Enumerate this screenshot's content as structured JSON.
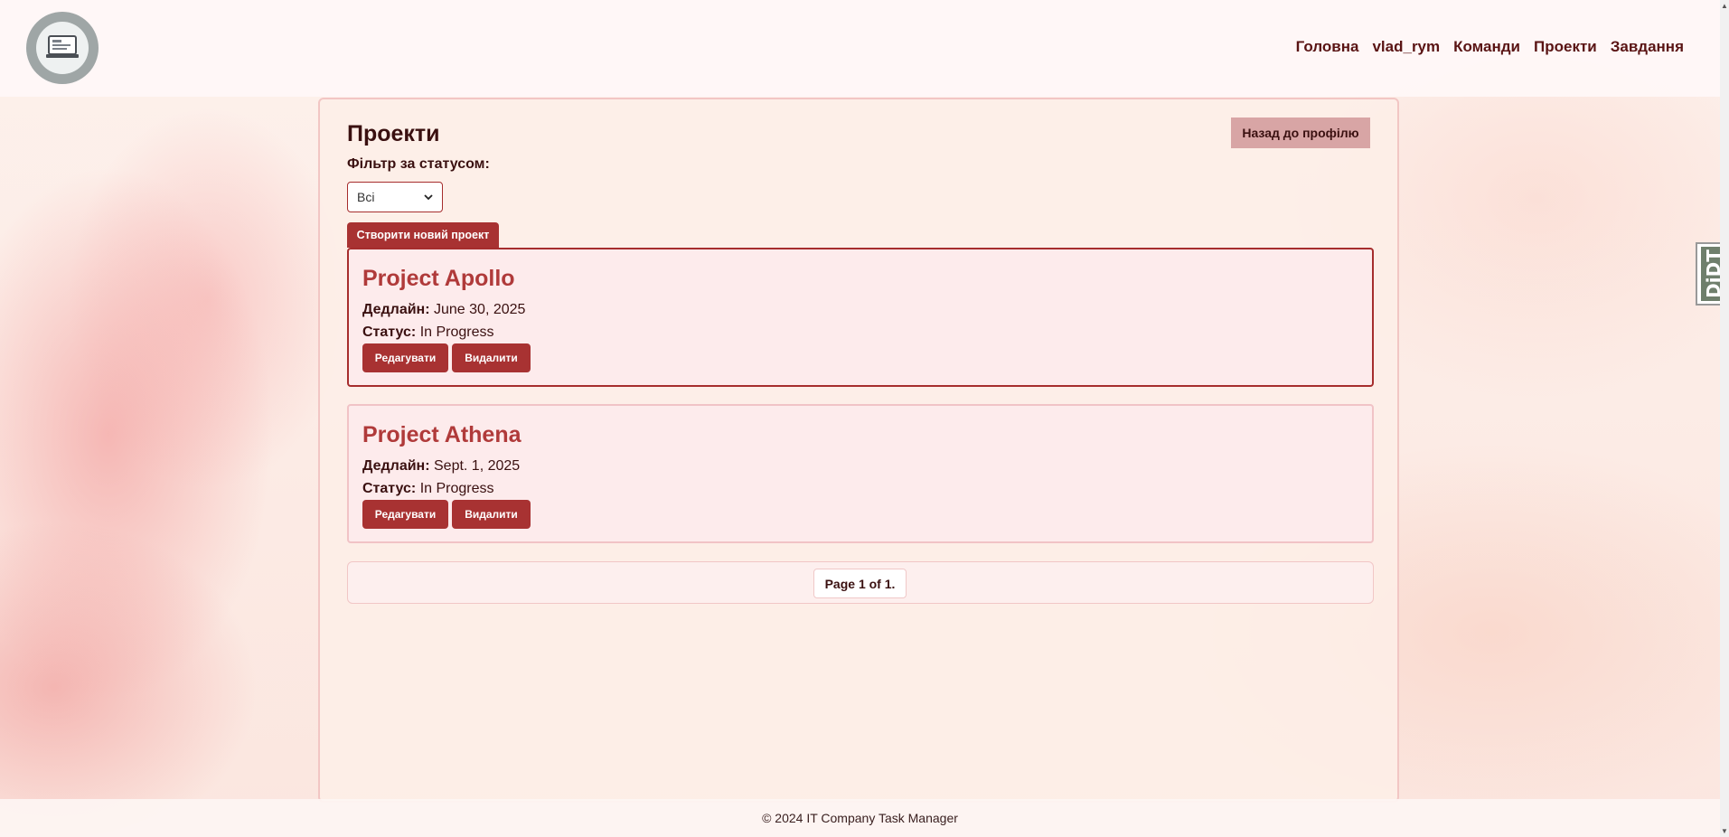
{
  "header": {
    "logo_icon": "laptop-logo-icon",
    "nav": [
      {
        "label": "Головна"
      },
      {
        "label": "vlad_rym"
      },
      {
        "label": "Команди"
      },
      {
        "label": "Проекти"
      },
      {
        "label": "Завдання"
      }
    ]
  },
  "main": {
    "title": "Проекти",
    "back_button": "Назад до профілю",
    "filter": {
      "label": "Фільтр за статусом:",
      "selected": "Всі"
    },
    "create_button": "Створити новий проект",
    "projects": [
      {
        "name": "Project Apollo",
        "deadline_label": "Дедлайн:",
        "deadline": "June 30, 2025",
        "status_label": "Статус:",
        "status": "In Progress",
        "edit_label": "Редагувати",
        "delete_label": "Видалити"
      },
      {
        "name": "Project Athena",
        "deadline_label": "Дедлайн:",
        "deadline": "Sept. 1, 2025",
        "status_label": "Статус:",
        "status": "In Progress",
        "edit_label": "Редагувати",
        "delete_label": "Видалити"
      }
    ],
    "pagination": {
      "current": "Page 1 of 1."
    }
  },
  "footer": {
    "text": "© 2024 IT Company Task Manager"
  },
  "debug_toolbar": {
    "label": "DjDT"
  },
  "colors": {
    "accent": "#a83232",
    "title_text": "#b03a3a",
    "nav_text": "#5a1414"
  }
}
